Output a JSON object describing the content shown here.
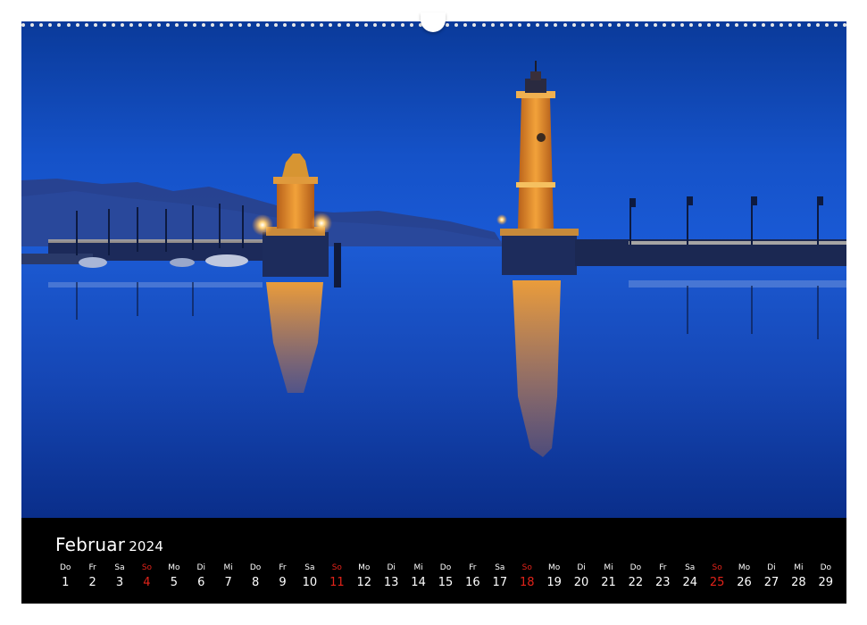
{
  "calendar": {
    "month": "Februar",
    "year": "2024",
    "sunday_color": "#e2231a",
    "days": [
      {
        "wd": "Do",
        "d": "1",
        "sun": false
      },
      {
        "wd": "Fr",
        "d": "2",
        "sun": false
      },
      {
        "wd": "Sa",
        "d": "3",
        "sun": false
      },
      {
        "wd": "So",
        "d": "4",
        "sun": true
      },
      {
        "wd": "Mo",
        "d": "5",
        "sun": false
      },
      {
        "wd": "Di",
        "d": "6",
        "sun": false
      },
      {
        "wd": "Mi",
        "d": "7",
        "sun": false
      },
      {
        "wd": "Do",
        "d": "8",
        "sun": false
      },
      {
        "wd": "Fr",
        "d": "9",
        "sun": false
      },
      {
        "wd": "Sa",
        "d": "10",
        "sun": false
      },
      {
        "wd": "So",
        "d": "11",
        "sun": true
      },
      {
        "wd": "Mo",
        "d": "12",
        "sun": false
      },
      {
        "wd": "Di",
        "d": "13",
        "sun": false
      },
      {
        "wd": "Mi",
        "d": "14",
        "sun": false
      },
      {
        "wd": "Do",
        "d": "15",
        "sun": false
      },
      {
        "wd": "Fr",
        "d": "16",
        "sun": false
      },
      {
        "wd": "Sa",
        "d": "17",
        "sun": false
      },
      {
        "wd": "So",
        "d": "18",
        "sun": true
      },
      {
        "wd": "Mo",
        "d": "19",
        "sun": false
      },
      {
        "wd": "Di",
        "d": "20",
        "sun": false
      },
      {
        "wd": "Mi",
        "d": "21",
        "sun": false
      },
      {
        "wd": "Do",
        "d": "22",
        "sun": false
      },
      {
        "wd": "Fr",
        "d": "23",
        "sun": false
      },
      {
        "wd": "Sa",
        "d": "24",
        "sun": false
      },
      {
        "wd": "So",
        "d": "25",
        "sun": true
      },
      {
        "wd": "Mo",
        "d": "26",
        "sun": false
      },
      {
        "wd": "Di",
        "d": "27",
        "sun": false
      },
      {
        "wd": "Mi",
        "d": "28",
        "sun": false
      },
      {
        "wd": "Do",
        "d": "29",
        "sun": false
      }
    ]
  }
}
